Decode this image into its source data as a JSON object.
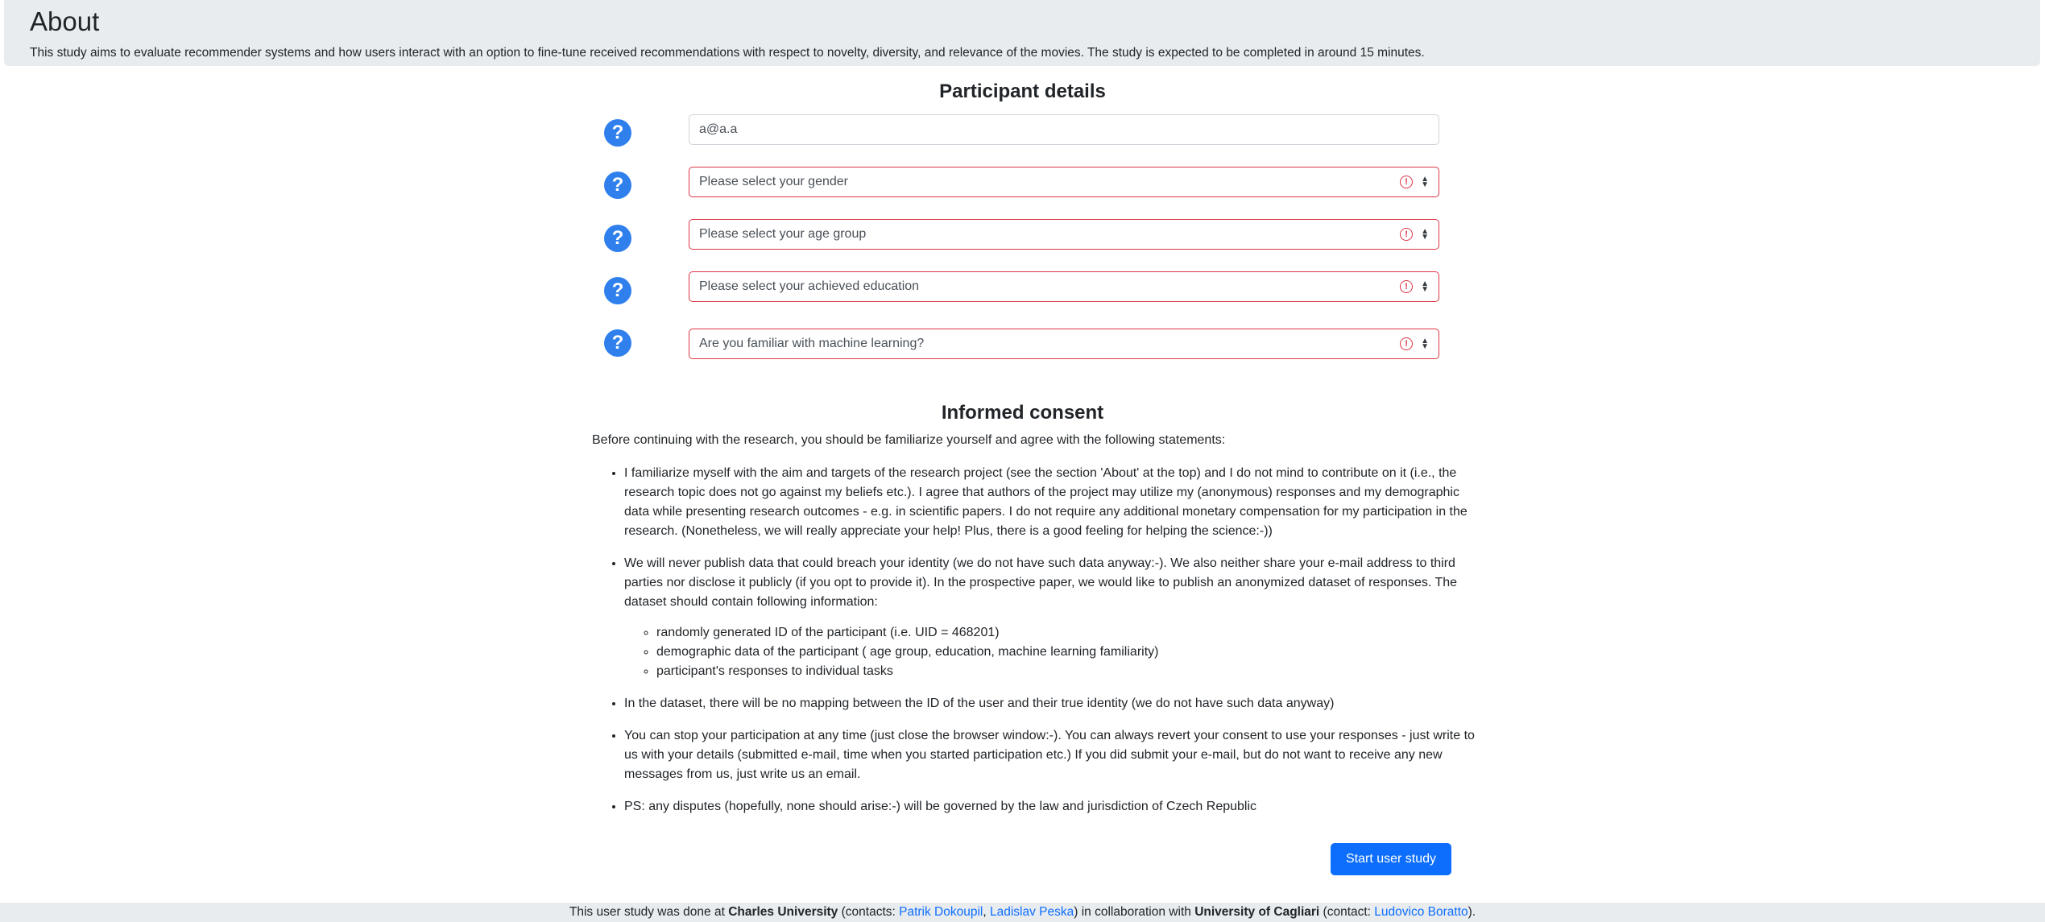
{
  "about": {
    "title": "About",
    "description": "This study aims to evaluate recommender systems and how users interact with an option to fine-tune received recommendations with respect to novelty, diversity, and relevance of the movies. The study is expected to be completed in around 15 minutes."
  },
  "participant": {
    "title": "Participant details",
    "help_glyph": "?",
    "email_value": "a@a.a",
    "gender_placeholder": "Please select your gender",
    "age_placeholder": "Please select your age group",
    "education_placeholder": "Please select your achieved education",
    "ml_placeholder": "Are you familiar with machine learning?"
  },
  "consent": {
    "title": "Informed consent",
    "intro": "Before continuing with the research, you should be familiarize yourself and agree with the following statements:",
    "items": [
      "I familiarize myself with the aim and targets of the research project (see the section 'About' at the top) and I do not mind to contribute on it (i.e., the research topic does not go against my beliefs etc.). I agree that authors of the project may utilize my (anonymous) responses and my demographic data while presenting research outcomes - e.g. in scientific papers. I do not require any additional monetary compensation for my participation in the research. (Nonetheless, we will really appreciate your help! Plus, there is a good feeling for helping the science:-))",
      "We will never publish data that could breach your identity (we do not have such data anyway:-). We also neither share your e-mail address to third parties nor disclose it publicly (if you opt to provide it). In the prospective paper, we would like to publish an anonymized dataset of responses. The dataset should contain following information:",
      "In the dataset, there will be no mapping between the ID of the user and their true identity (we do not have such data anyway)",
      "You can stop your participation at any time (just close the browser window:-). You can always revert your consent to use your responses - just write to us with your details (submitted e-mail, time when you started participation etc.) If you did submit your e-mail, but do not want to receive any new messages from us, just write us an email.",
      "PS: any disputes (hopefully, none should arise:-) will be governed by the law and jurisdiction of Czech Republic"
    ],
    "subitems": [
      "randomly generated ID of the participant (i.e. UID = 468201)",
      "demographic data of the participant ( age group, education, machine learning familiarity)",
      "participant's responses to individual tasks"
    ]
  },
  "start_button": "Start user study",
  "footer": {
    "t1": "This user study was done at ",
    "org1": "Charles University",
    "t2": " (contacts: ",
    "c1": "Patrik Dokoupil",
    "sep": ", ",
    "c2": "Ladislav Peska",
    "t3": ") in collaboration with ",
    "org2": "University of Cagliari",
    "t4": " (contact: ",
    "c3": "Ludovico Boratto",
    "t5": ")."
  }
}
